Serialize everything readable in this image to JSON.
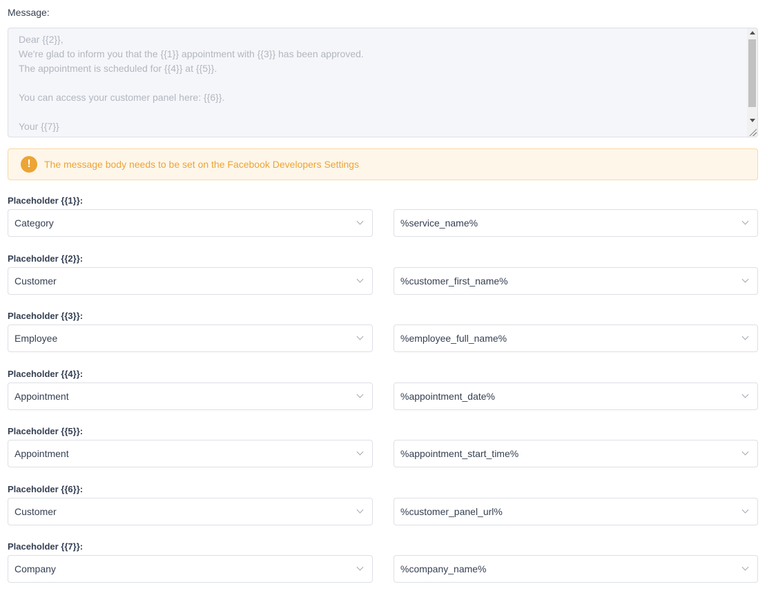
{
  "message": {
    "label": "Message:",
    "placeholder_text": "Dear {{2}},\nWe're glad to inform you that the {{1}} appointment with {{3}} has been approved.\nThe appointment is scheduled for {{4}} at {{5}}.\n\nYou can access your customer panel here: {{6}}.\n\nYour {{7}}\n..."
  },
  "alert": {
    "text": "The message body needs to be set on the Facebook Developers Settings",
    "icon": "exclamation-icon",
    "color": "#eca435"
  },
  "placeholders": [
    {
      "label": "Placeholder {{1}}:",
      "category": "Category",
      "value": "%service_name%"
    },
    {
      "label": "Placeholder {{2}}:",
      "category": "Customer",
      "value": "%customer_first_name%"
    },
    {
      "label": "Placeholder {{3}}:",
      "category": "Employee",
      "value": "%employee_full_name%"
    },
    {
      "label": "Placeholder {{4}}:",
      "category": "Appointment",
      "value": "%appointment_date%"
    },
    {
      "label": "Placeholder {{5}}:",
      "category": "Appointment",
      "value": "%appointment_start_time%"
    },
    {
      "label": "Placeholder {{6}}:",
      "category": "Customer",
      "value": "%customer_panel_url%"
    },
    {
      "label": "Placeholder {{7}}:",
      "category": "Company",
      "value": "%company_name%"
    }
  ]
}
